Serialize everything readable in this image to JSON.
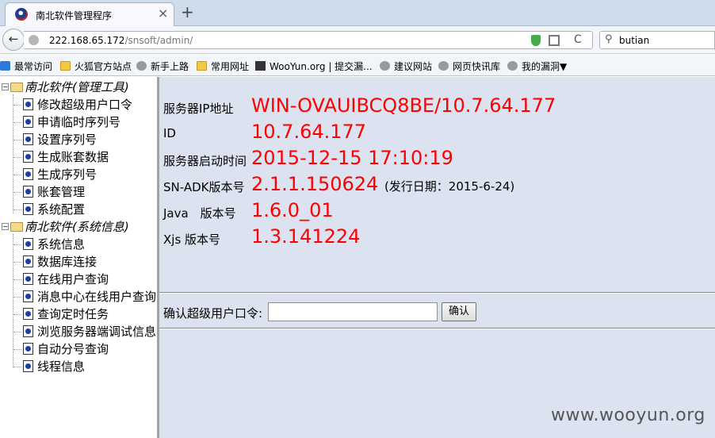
{
  "browser": {
    "tab_title": "南北软件管理程序",
    "tab_close": "×",
    "new_tab": "+",
    "back": "←",
    "url_host": "222.168.65.172",
    "url_path": "/snsoft/admin/",
    "refresh": "C",
    "search_value": "butian",
    "bookmarks": [
      {
        "label": "最常访问",
        "icon": "bookmark-star-icon"
      },
      {
        "label": "火狐官方站点",
        "icon": "folder-icon"
      },
      {
        "label": "新手上路",
        "icon": "globe-icon"
      },
      {
        "label": "常用网址",
        "icon": "folder-icon"
      },
      {
        "label": "WooYun.org | 提交漏...",
        "icon": "wooyun-icon"
      },
      {
        "label": "建议网站",
        "icon": "globe-icon"
      },
      {
        "label": "网页快讯库",
        "icon": "globe-icon"
      },
      {
        "label": "我的漏洞▼",
        "icon": "globe-icon"
      }
    ]
  },
  "tree": {
    "group1": {
      "label": "南北软件(管理工具)",
      "toggle": "−"
    },
    "group1_items": [
      "修改超级用户口令",
      "申请临时序列号",
      "设置序列号",
      "生成账套数据",
      "生成序列号",
      "账套管理",
      "系统配置"
    ],
    "group2": {
      "label": "南北软件(系统信息)",
      "toggle": "−"
    },
    "group2_items": [
      "系统信息",
      "数据库连接",
      "在线用户查询",
      "消息中心在线用户查询",
      "查询定时任务",
      "浏览服务器端调试信息",
      "自动分号查询",
      "线程信息"
    ]
  },
  "info": {
    "rows": [
      {
        "label": "服务器IP地址",
        "value": "WIN-OVAUIBCQ8BE/10.7.64.177"
      },
      {
        "label": "ID",
        "value": "10.7.64.177"
      },
      {
        "label": "服务器启动时间",
        "value": "2015-12-15 17:10:19"
      },
      {
        "label": "SN-ADK版本号",
        "value": "2.1.1.150624",
        "note": "(发行日期：2015-6-24)"
      },
      {
        "label": "Java　版本号",
        "value": "1.6.0_01"
      },
      {
        "label": "Xjs 版本号",
        "value": "1.3.141224"
      }
    ]
  },
  "confirm": {
    "label": "确认超级用户口令:",
    "input_value": "",
    "button": "确认"
  },
  "watermark": "www.wooyun.org",
  "colors": {
    "value_text": "#ff0000",
    "content_bg": "#dce2ef"
  }
}
